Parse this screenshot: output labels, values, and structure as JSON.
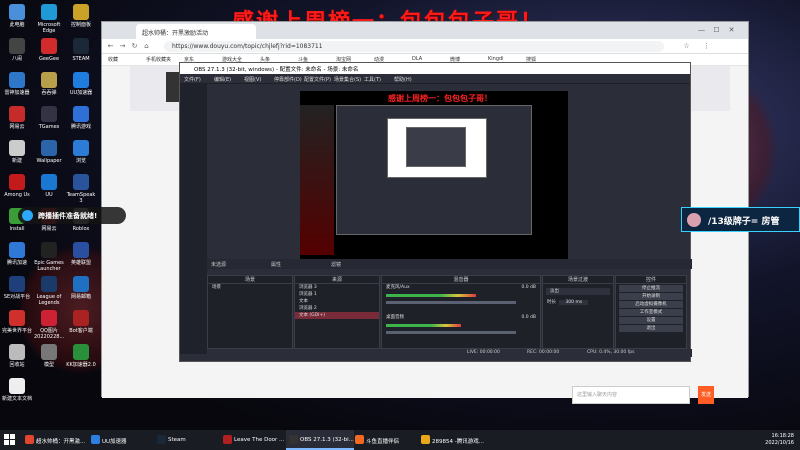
{
  "banner": {
    "text": "感谢上周榜一：包包包子哥！"
  },
  "desktop_icons": [
    {
      "label": "此电脑",
      "color": "#4a8fd9"
    },
    {
      "label": "Microsoft Edge",
      "color": "#1f9ad6"
    },
    {
      "label": "控制面板",
      "color": "#c9a227"
    },
    {
      "label": "八闹",
      "color": "#444"
    },
    {
      "label": "GeeGee",
      "color": "#d22b2b"
    },
    {
      "label": "STEAM",
      "color": "#1b2838"
    },
    {
      "label": "雷神加速器",
      "color": "#2e76c7"
    },
    {
      "label": "吞吞弹",
      "color": "#b8a04a"
    },
    {
      "label": "UU加速器",
      "color": "#1f7de0"
    },
    {
      "label": "网易云",
      "color": "#c52b2b"
    },
    {
      "label": "TGames",
      "color": "#334"
    },
    {
      "label": "腾讯游戏",
      "color": "#2f6fd8"
    },
    {
      "label": "新建",
      "color": "#ccc"
    },
    {
      "label": "Wallpaper",
      "color": "#2b64a8"
    },
    {
      "label": "浏览",
      "color": "#2c7bd6"
    },
    {
      "label": "Among Us",
      "color": "#c31b1b"
    },
    {
      "label": "UU",
      "color": "#1a77d2"
    },
    {
      "label": "TeamSpeak 3",
      "color": "#29539b"
    },
    {
      "label": "Install",
      "color": "#3a9d3a"
    },
    {
      "label": "网易云",
      "color": "#c32020"
    },
    {
      "label": "Roblox",
      "color": "#888"
    },
    {
      "label": "腾讯加速",
      "color": "#2f78d8"
    },
    {
      "label": "Epic Games Launcher",
      "color": "#222"
    },
    {
      "label": "英雄联盟",
      "color": "#2a4fa0"
    },
    {
      "label": "SE对战平台",
      "color": "#1e3f7a"
    },
    {
      "label": "League of Legends",
      "color": "#1a3b6a"
    },
    {
      "label": "网易邮箱",
      "color": "#1f6fc2"
    },
    {
      "label": "完美世界平台",
      "color": "#d0302b"
    },
    {
      "label": "QQ图片 20220228...",
      "color": "#c23"
    },
    {
      "label": "Bot客户端",
      "color": "#a22"
    },
    {
      "label": "回收站",
      "color": "#bbb"
    },
    {
      "label": "模型",
      "color": "#777"
    },
    {
      "label": "KK加速器2.0",
      "color": "#2a8f3a"
    },
    {
      "label": "新建文本文档",
      "color": "#eee"
    }
  ],
  "browser": {
    "tab_title": "超水帅桶：开黑激励活动",
    "url": "https://www.douyu.com/topic/chjlefj?rid=1083711",
    "bookmarks": [
      "收藏",
      "手机收藏夹",
      "京东",
      "游戏大全",
      "头条",
      "斗鱼",
      "淘宝网",
      "动漫",
      "DLA",
      "微博",
      "Kingdi",
      "搜狐"
    ],
    "chat_placeholder": "这里输入聊天内容",
    "send_label": "发送"
  },
  "obs": {
    "title": "OBS 27.1.3 (32-bit, windows) - 配置文件: 未命名 - 场景: 未命名",
    "menu": [
      "文件(F)",
      "编辑(E)",
      "视图(V)",
      "停靠部件(D)",
      "配置文件(P)",
      "场景集合(S)",
      "工具(T)",
      "帮助(H)"
    ],
    "preview_overlay": "感谢上周榜一：包包包子哥！",
    "dock_labels": [
      "未选源",
      "属性",
      "滤镜"
    ],
    "scenes": {
      "header": "场景",
      "items": [
        "场景"
      ]
    },
    "sources": {
      "header": "来源",
      "items": [
        "浏览器 3",
        "浏览器 1",
        "文本",
        "浏览器 2",
        "文本 (GDI+)"
      ]
    },
    "mixer": {
      "header": "混音器",
      "channels": [
        {
          "name": "麦克风/Aux",
          "db": "0.0 dB",
          "level": 0.6
        },
        {
          "name": "桌面音频",
          "db": "0.0 dB",
          "level": 0.5
        }
      ]
    },
    "transitions": {
      "header": "场景过渡",
      "type": "淡出",
      "duration_label": "时长",
      "duration": "300 ms"
    },
    "controls": {
      "header": "控件",
      "buttons": [
        "停止推流",
        "开始录制",
        "启动虚拟摄像机",
        "工作室模式",
        "设置",
        "退出"
      ]
    },
    "status": [
      "LIVE: 00:00:00",
      "REC: 00:00:00",
      "CPU: 0.4%, 30.00 fps"
    ]
  },
  "overlays": {
    "plugin_badge": "跨播插件准备就绪!",
    "admin_badge": "/13级牌子= 房管"
  },
  "taskbar": {
    "items": [
      {
        "label": "超水帅桶：开黑激...",
        "color": "#e0452e"
      },
      {
        "label": "UU加速器",
        "color": "#2c7fe0"
      },
      {
        "label": "Steam",
        "color": "#1b2838"
      },
      {
        "label": "Leave The Door ...",
        "color": "#b02020"
      },
      {
        "label": "OBS 27.1.3 (32-bi...",
        "color": "#333"
      },
      {
        "label": "斗鱼直播伴侣",
        "color": "#f26a21"
      },
      {
        "label": "289854 -腾讯游戏...",
        "color": "#e8a81a"
      }
    ],
    "time": "16:18:28",
    "date": "2022/10/16"
  }
}
